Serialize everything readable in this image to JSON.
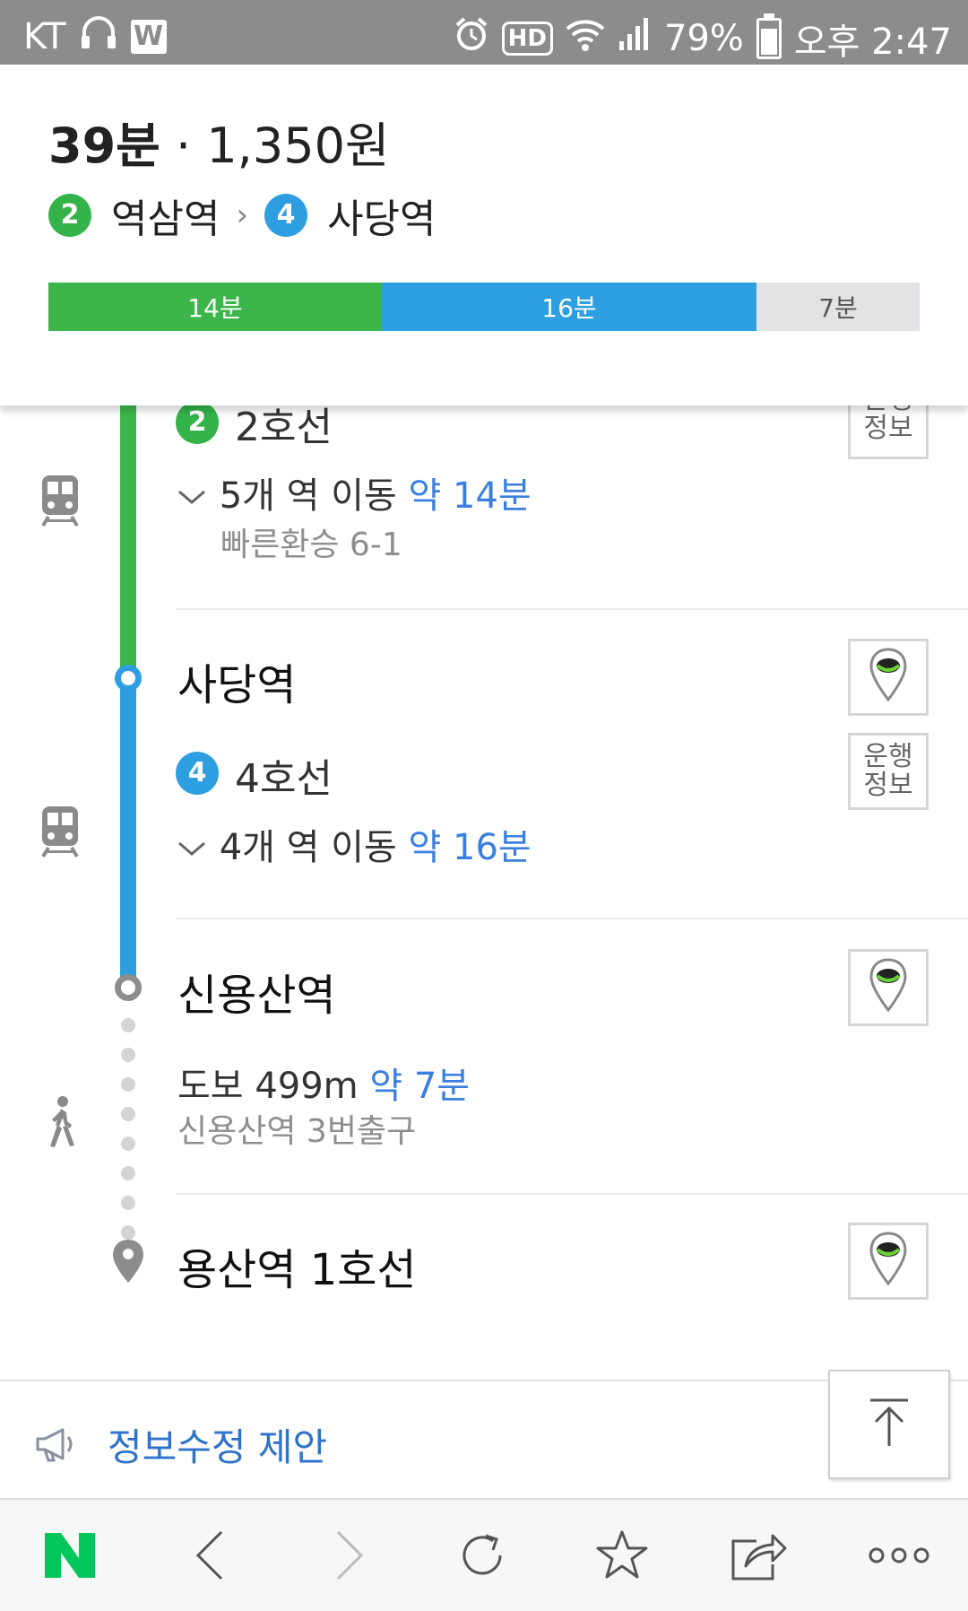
{
  "status_bar": {
    "carrier": "KT",
    "app_badge": "W",
    "hd_label": "HD",
    "battery_percent": "79%",
    "battery_level": 0.79,
    "time": "오후 2:47"
  },
  "summary": {
    "duration": "39분",
    "separator": " · ",
    "fare": "1,350원",
    "from_line": "2",
    "from_station": "역삼역",
    "chevron": "›",
    "to_line": "4",
    "to_station": "사당역",
    "segments": [
      {
        "label": "14분",
        "minutes": 14,
        "color": "#3cb64a"
      },
      {
        "label": "16분",
        "minutes": 16,
        "color": "#2d9fe0"
      },
      {
        "label": "7분",
        "minutes": 7,
        "color": "#e3e3e6"
      }
    ]
  },
  "steps": {
    "line2": {
      "badge": "2",
      "name": "2호선",
      "move_prefix": "5개 역 이동 ",
      "move_time": "약 14분",
      "transfer": "빠른환승 6-1",
      "info_button": "운행\n정보"
    },
    "sadang": {
      "station": "사당역"
    },
    "line4": {
      "badge": "4",
      "name": "4호선",
      "move_prefix": "4개 역 이동 ",
      "move_time": "약 16분",
      "info_button_line1": "운행",
      "info_button_line2": "정보"
    },
    "sinyongsan": {
      "station": "신용산역"
    },
    "walk": {
      "prefix": "도보 499m ",
      "time": "약 7분",
      "exit": "신용산역 3번출구"
    },
    "destination": {
      "station": "용산역 1호선"
    }
  },
  "footer": {
    "suggest_label": "정보수정 제안"
  },
  "colors": {
    "line2": "#3cb64a",
    "line4": "#2d9fe0",
    "link_blue": "#3a7fe0",
    "naver_green": "#03c75a"
  },
  "icons": {
    "subway": "subway-icon",
    "walk": "walking-person-icon",
    "map_pin": "map-pin-icon",
    "megaphone": "megaphone-icon",
    "scroll_top": "arrow-up-icon"
  }
}
